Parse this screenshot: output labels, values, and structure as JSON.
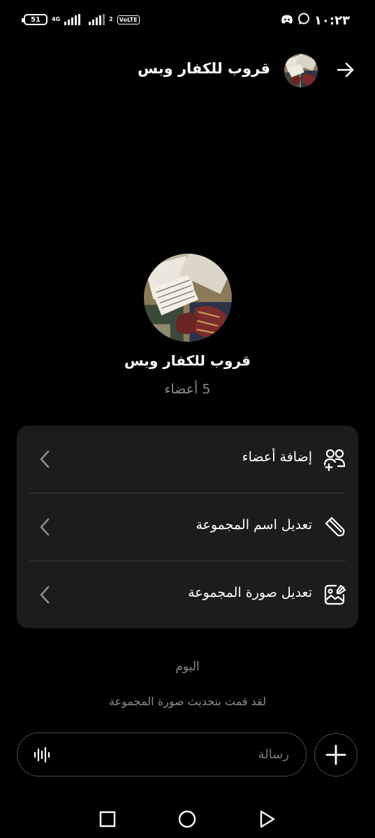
{
  "status_bar": {
    "time": "١٠:٢٣",
    "battery": "51",
    "network": "4G",
    "volte": "VoLTE",
    "sim2": "2"
  },
  "header": {
    "title": "قروب للكفار وبس",
    "back_icon": "arrow-right-icon"
  },
  "group": {
    "name": "قروب للكفار وبس",
    "members": "5 أعضاء"
  },
  "menu": {
    "items": [
      {
        "label": "إضافة أعضاء",
        "icon": "add-members-icon"
      },
      {
        "label": "تعديل اسم المجموعة",
        "icon": "pencil-icon"
      },
      {
        "label": "تعديل صورة المجموعة",
        "icon": "edit-image-icon"
      }
    ]
  },
  "chat": {
    "day_label": "اليوم",
    "system_message": "لقد قمت بتحديث صورة المجموعة"
  },
  "composer": {
    "placeholder": "رسالة"
  },
  "colors": {
    "background": "#000000",
    "card": "#1c1c1e",
    "secondary_text": "#8c8c8c"
  }
}
